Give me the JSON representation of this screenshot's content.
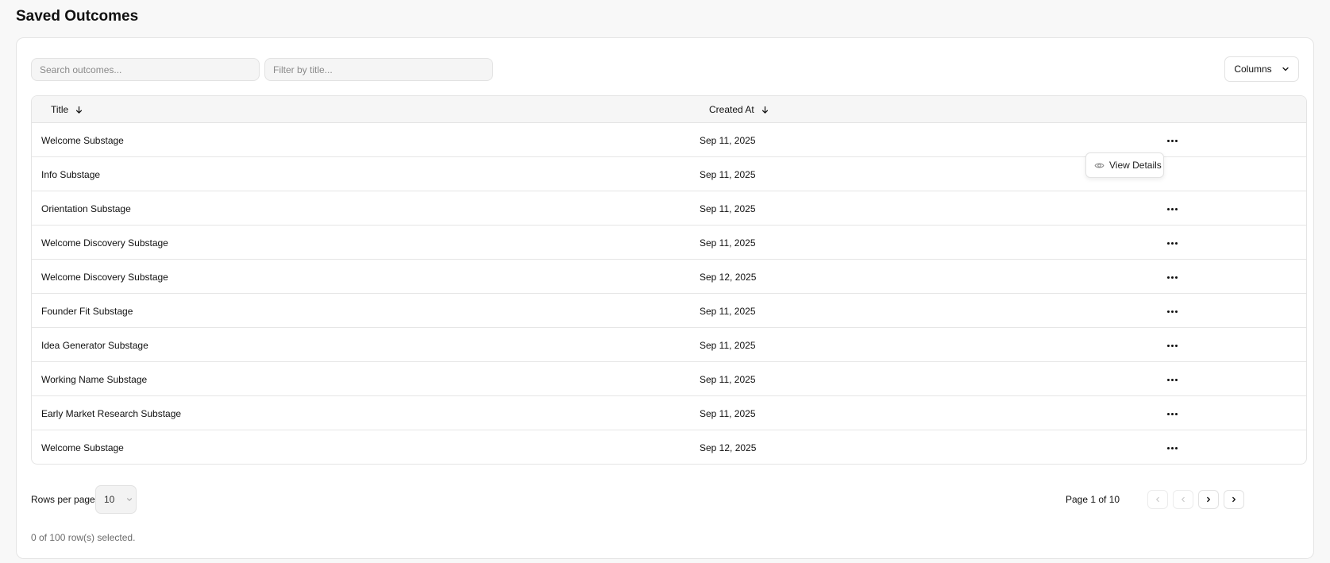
{
  "page": {
    "title": "Saved Outcomes"
  },
  "toolbar": {
    "search_placeholder": "Search outcomes...",
    "filter_placeholder": "Filter by title...",
    "columns_label": "Columns"
  },
  "table": {
    "columns": [
      {
        "label": "Title",
        "sort": "desc",
        "sort_icon": "arrow-down-icon"
      },
      {
        "label": "Created At",
        "sort": "desc",
        "sort_icon": "arrow-down-icon"
      }
    ],
    "rows": [
      {
        "title": "Welcome Substage",
        "created_at": "Sep 11, 2025"
      },
      {
        "title": "Info Substage",
        "created_at": "Sep 11, 2025"
      },
      {
        "title": "Orientation Substage",
        "created_at": "Sep 11, 2025"
      },
      {
        "title": "Welcome Discovery Substage",
        "created_at": "Sep 11, 2025"
      },
      {
        "title": "Welcome Discovery Substage",
        "created_at": "Sep 12, 2025"
      },
      {
        "title": "Founder Fit Substage",
        "created_at": "Sep 11, 2025"
      },
      {
        "title": "Idea Generator Substage",
        "created_at": "Sep 11, 2025"
      },
      {
        "title": "Working Name Substage",
        "created_at": "Sep 11, 2025"
      },
      {
        "title": "Early Market Research Substage",
        "created_at": "Sep 11, 2025"
      },
      {
        "title": "Welcome Substage",
        "created_at": "Sep 12, 2025"
      }
    ]
  },
  "row_menu": {
    "view_details_label": "View Details",
    "icon": "eye-icon"
  },
  "pagination": {
    "rows_per_page_label": "Rows per page",
    "rows_per_page_value": "10",
    "page_info": "Page 1 of 10"
  },
  "selection_status": "0 of 100 row(s) selected.",
  "colors": {
    "background": "#f8f8f8",
    "card": "#ffffff",
    "header_bg": "#f6f6f6",
    "border": "#e4e4e4",
    "muted_text": "#6b6b6b"
  }
}
